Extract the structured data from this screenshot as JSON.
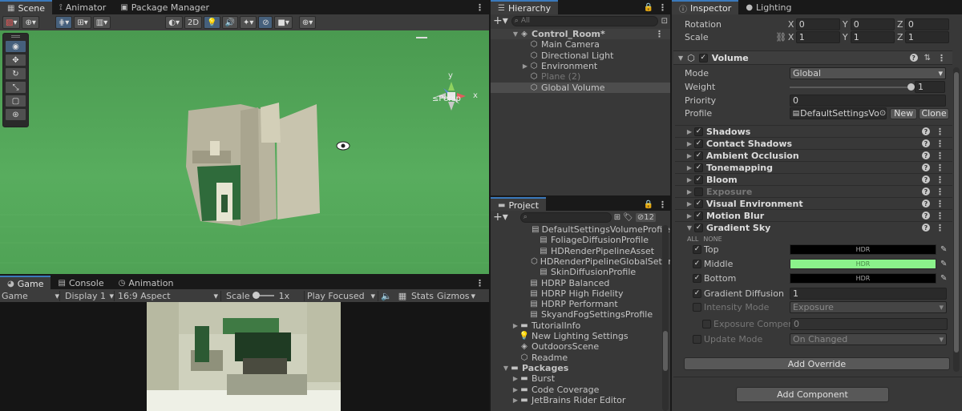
{
  "scene_window": {
    "tabs": [
      {
        "label": "Scene",
        "icon": "scene-icon"
      },
      {
        "label": "Animator",
        "icon": "animator-icon"
      },
      {
        "label": "Package Manager",
        "icon": "package-icon"
      }
    ],
    "toolbar": {
      "btn_2d": "2D"
    },
    "gizmo": {
      "y_label": "y",
      "x_label": "x",
      "persp_label": "≤Persp"
    },
    "sky_color": "#4fa255"
  },
  "game_window": {
    "tabs": [
      {
        "label": "Game",
        "icon": "game-icon"
      },
      {
        "label": "Console",
        "icon": "console-icon"
      },
      {
        "label": "Animation",
        "icon": "animation-icon"
      }
    ],
    "toolbar": {
      "mode": "Game",
      "display": "Display 1",
      "aspect": "16:9 Aspect",
      "scale_label": "Scale",
      "scale_value": "1x",
      "play_mode": "Play Focused",
      "stats": "Stats",
      "gizmos": "Gizmos"
    }
  },
  "hierarchy": {
    "tab_label": "Hierarchy",
    "search_placeholder": "All",
    "items": [
      {
        "label": "Control_Room*",
        "depth": 0,
        "bold": true,
        "expander": "open"
      },
      {
        "label": "Main Camera",
        "depth": 1
      },
      {
        "label": "Directional Light",
        "depth": 1
      },
      {
        "label": "Environment",
        "depth": 1,
        "expander": "closed"
      },
      {
        "label": "Plane (2)",
        "depth": 1,
        "disabled": true
      },
      {
        "label": "Global Volume",
        "depth": 1,
        "selected": true
      }
    ]
  },
  "project": {
    "tab_label": "Project",
    "hidden_count": "12",
    "items": [
      {
        "label": "DefaultSettingsVolumeProfile",
        "depth": 2
      },
      {
        "label": "FoliageDiffusionProfile",
        "depth": 2
      },
      {
        "label": "HDRenderPipelineAsset",
        "depth": 2
      },
      {
        "label": "HDRenderPipelineGlobalSetting",
        "depth": 2
      },
      {
        "label": "SkinDiffusionProfile",
        "depth": 2
      },
      {
        "label": "HDRP Balanced",
        "depth": 1
      },
      {
        "label": "HDRP High Fidelity",
        "depth": 1
      },
      {
        "label": "HDRP Performant",
        "depth": 1
      },
      {
        "label": "SkyandFogSettingsProfile",
        "depth": 1
      },
      {
        "label": "TutorialInfo",
        "depth": 0,
        "folder": true,
        "expander": "closed"
      },
      {
        "label": "New Lighting Settings",
        "depth": 0
      },
      {
        "label": "OutdoorsScene",
        "depth": 0
      },
      {
        "label": "Readme",
        "depth": 0
      },
      {
        "label": "Packages",
        "depth": -1,
        "folder": true,
        "expander": "open",
        "bold": true
      },
      {
        "label": "Burst",
        "depth": 0,
        "folder": true,
        "expander": "closed"
      },
      {
        "label": "Code Coverage",
        "depth": 0,
        "folder": true,
        "expander": "closed"
      },
      {
        "label": "JetBrains Rider Editor",
        "depth": 0,
        "folder": true,
        "expander": "closed"
      }
    ]
  },
  "inspector": {
    "tabs": [
      {
        "label": "Inspector",
        "icon": "inspector-icon"
      },
      {
        "label": "Lighting",
        "icon": "lighting-icon"
      }
    ],
    "transform": {
      "rotation_label": "Rotation",
      "scale_label": "Scale",
      "rotation": {
        "x": "X",
        "x_val": "0",
        "y": "Y",
        "y_val": "0",
        "z": "Z",
        "z_val": "0"
      },
      "scale": {
        "x": "X",
        "x_val": "1",
        "y": "Y",
        "y_val": "1",
        "z": "Z",
        "z_val": "1"
      }
    },
    "volume": {
      "title": "Volume",
      "mode_label": "Mode",
      "mode_value": "Global",
      "weight_label": "Weight",
      "weight_value": "1",
      "weight_fraction": 1.0,
      "priority_label": "Priority",
      "priority_value": "0",
      "profile_label": "Profile",
      "profile_value": "DefaultSettingsVolui",
      "new_btn": "New",
      "clone_btn": "Clone"
    },
    "overrides": [
      {
        "label": "Shadows",
        "checked": true
      },
      {
        "label": "Contact Shadows",
        "checked": true
      },
      {
        "label": "Ambient Occlusion",
        "checked": true
      },
      {
        "label": "Tonemapping",
        "checked": true
      },
      {
        "label": "Bloom",
        "checked": true
      },
      {
        "label": "Exposure",
        "checked": false,
        "dim": true
      },
      {
        "label": "Visual Environment",
        "checked": true
      },
      {
        "label": "Motion Blur",
        "checked": true
      },
      {
        "label": "Gradient Sky",
        "checked": true,
        "expanded": true
      }
    ],
    "gradient_sky": {
      "all_label": "ALL",
      "none_label": "NONE",
      "top_label": "Top",
      "top_color": "#000000",
      "middle_label": "Middle",
      "middle_color": "#8bf28b",
      "bottom_label": "Bottom",
      "bottom_color": "#000000",
      "hdr_label": "HDR",
      "diffusion_label": "Gradient Diffusion",
      "diffusion_value": "1",
      "intensity_label": "Intensity Mode",
      "intensity_value": "Exposure",
      "exposure_comp_label": "Exposure Compens",
      "exposure_comp_value": "0",
      "update_label": "Update Mode",
      "update_value": "On Changed"
    },
    "add_override": "Add Override",
    "add_component": "Add Component"
  },
  "colors": {
    "accent": "#3a79bb",
    "panel": "#383838",
    "selection": "#4d4d4d"
  }
}
